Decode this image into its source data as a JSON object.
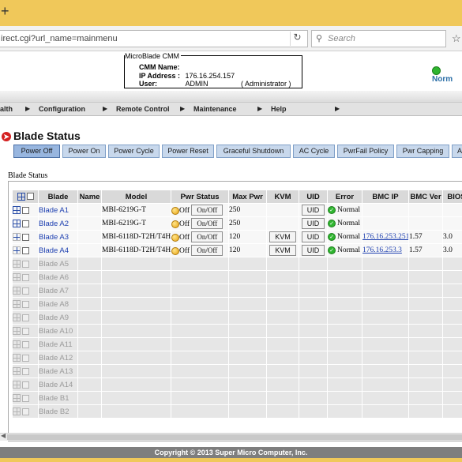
{
  "browser": {
    "new_tab": "+",
    "url": "irect.cgi?url_name=mainmenu",
    "search_placeholder": "Search"
  },
  "header": {
    "legend": "MicroBlade CMM",
    "cmm_name_label": "CMM Name:",
    "cmm_name_value": "",
    "ip_label": "IP Address :",
    "ip_value": "176.16.254.157",
    "user_label": "User:",
    "user_value": "ADMIN",
    "user_role": "( Administrator )",
    "status_text": "Norm"
  },
  "menu": {
    "items": [
      "alth",
      "Configuration",
      "Remote Control",
      "Maintenance",
      "Help"
    ]
  },
  "page_title": "Blade Status",
  "actions": [
    "Power Off",
    "Power On",
    "Power Cycle",
    "Power Reset",
    "Graceful Shutdown",
    "AC Cycle",
    "PwrFail Policy",
    "Pwr Capping",
    "A"
  ],
  "group_legend": "Blade Status",
  "table": {
    "headers": [
      "Blade",
      "Name",
      "Model",
      "Pwr Status",
      "Max Pwr",
      "KVM",
      "UID",
      "Error",
      "BMC IP",
      "BMC Ver",
      "BIOS"
    ],
    "rows": [
      {
        "blade": "Blade A1",
        "name": "",
        "model": "MBI-6219G-T",
        "pwr": "Off",
        "pwr_btn": "On/Off",
        "max_pwr": "250",
        "kvm": "",
        "uid": "UID",
        "error": "Normal",
        "bmc_ip": "",
        "bmc_ver": "",
        "bios": ""
      },
      {
        "blade": "Blade A2",
        "name": "",
        "model": "MBI-6219G-T",
        "pwr": "Off",
        "pwr_btn": "On/Off",
        "max_pwr": "250",
        "kvm": "",
        "uid": "UID",
        "error": "Normal",
        "bmc_ip": "",
        "bmc_ver": "",
        "bios": ""
      },
      {
        "blade": "Blade A3",
        "name": "",
        "model": "MBI-6118D-T2H/T4H",
        "pwr": "Off",
        "pwr_btn": "On/Off",
        "max_pwr": "120",
        "kvm": "KVM",
        "uid": "UID",
        "error": "Normal",
        "bmc_ip": "176.16.253.251",
        "bmc_ver": "1.57",
        "bios": "3.0"
      },
      {
        "blade": "Blade A4",
        "name": "",
        "model": "MBI-6118D-T2H/T4H",
        "pwr": "Off",
        "pwr_btn": "On/Off",
        "max_pwr": "120",
        "kvm": "KVM",
        "uid": "UID",
        "error": "Normal",
        "bmc_ip": "176.16.253.3",
        "bmc_ver": "1.57",
        "bios": "3.0"
      }
    ],
    "empty_slots": [
      "Blade A5",
      "Blade A6",
      "Blade A7",
      "Blade A8",
      "Blade A9",
      "Blade A10",
      "Blade A11",
      "Blade A12",
      "Blade A13",
      "Blade A14",
      "Blade B1",
      "Blade B2"
    ]
  },
  "footer": "Copyright © 2013 Super Micro Computer, Inc."
}
